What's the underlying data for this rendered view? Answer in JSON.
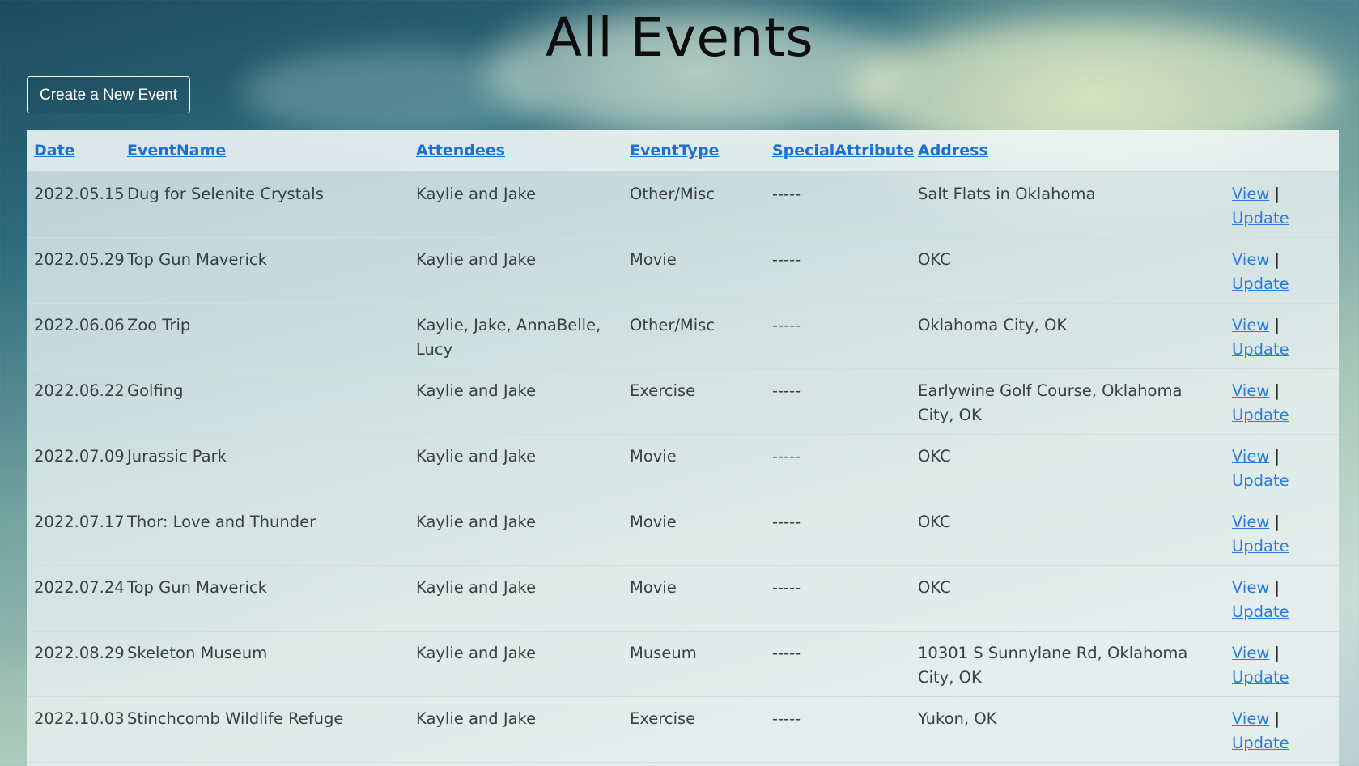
{
  "page": {
    "title": "All Events",
    "create_button": "Create a New Event"
  },
  "table": {
    "headers": {
      "date": "Date",
      "event_name": "EventName",
      "attendees": "Attendees",
      "event_type": "EventType",
      "special_attribute": "SpecialAttribute",
      "address": "Address"
    },
    "action_labels": {
      "view": "View",
      "separator": "|",
      "update": "Update"
    },
    "rows": [
      {
        "date": "2022.05.15",
        "event_name": "Dug for Selenite Crystals",
        "attendees": "Kaylie and Jake",
        "event_type": "Other/Misc",
        "special_attribute": "-----",
        "address": "Salt Flats in Oklahoma"
      },
      {
        "date": "2022.05.29",
        "event_name": "Top Gun Maverick",
        "attendees": "Kaylie and Jake",
        "event_type": "Movie",
        "special_attribute": "-----",
        "address": "OKC"
      },
      {
        "date": "2022.06.06",
        "event_name": "Zoo Trip",
        "attendees": "Kaylie, Jake, AnnaBelle, Lucy",
        "event_type": "Other/Misc",
        "special_attribute": "-----",
        "address": "Oklahoma City, OK"
      },
      {
        "date": "2022.06.22",
        "event_name": "Golfing",
        "attendees": "Kaylie and Jake",
        "event_type": "Exercise",
        "special_attribute": "-----",
        "address": "Earlywine Golf Course, Oklahoma City, OK"
      },
      {
        "date": "2022.07.09",
        "event_name": "Jurassic Park",
        "attendees": "Kaylie and Jake",
        "event_type": "Movie",
        "special_attribute": "-----",
        "address": "OKC"
      },
      {
        "date": "2022.07.17",
        "event_name": "Thor: Love and Thunder",
        "attendees": "Kaylie and Jake",
        "event_type": "Movie",
        "special_attribute": "-----",
        "address": "OKC"
      },
      {
        "date": "2022.07.24",
        "event_name": "Top Gun Maverick",
        "attendees": "Kaylie and Jake",
        "event_type": "Movie",
        "special_attribute": "-----",
        "address": "OKC"
      },
      {
        "date": "2022.08.29",
        "event_name": "Skeleton Museum",
        "attendees": "Kaylie and Jake",
        "event_type": "Museum",
        "special_attribute": "-----",
        "address": "10301 S Sunnylane Rd, Oklahoma City, OK"
      },
      {
        "date": "2022.10.03",
        "event_name": "Stinchcomb Wildlife Refuge",
        "attendees": "Kaylie and Jake",
        "event_type": "Exercise",
        "special_attribute": "-----",
        "address": "Yukon, OK"
      }
    ]
  },
  "colors": {
    "link": "#2a7be0",
    "header_link": "#1f6fd1",
    "text": "#3b3f42",
    "title": "#0d0d0d"
  }
}
